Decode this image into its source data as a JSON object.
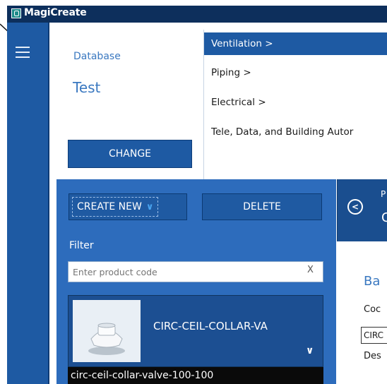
{
  "window": {
    "title": "MagiCreate",
    "icon": "app-logo-icon"
  },
  "nav": {
    "menu_icon": "hamburger-icon"
  },
  "database": {
    "label": "Database",
    "value": "Test",
    "change_label": "CHANGE"
  },
  "categories": [
    {
      "label": "Ventilation  >",
      "selected": true
    },
    {
      "label": "Piping  >",
      "selected": false
    },
    {
      "label": "Electrical  >",
      "selected": false
    },
    {
      "label": "Tele, Data, and Building Autor",
      "selected": false
    }
  ],
  "toolbar": {
    "create_label": "CREATE NEW",
    "create_icon": "chevron-down-icon",
    "delete_label": "DELETE"
  },
  "filter": {
    "label": "Filter",
    "placeholder": "Enter product code",
    "clear_label": "X"
  },
  "product": {
    "name": "CIRC-CEIL-COLLAR-VA",
    "description": "circ-ceil-collar-valve-100-100",
    "thumbnail_icon": "ceiling-valve-image",
    "expand_icon": "chevron-down-icon"
  },
  "details": {
    "back_icon": "back-circle-icon",
    "header_small": "P",
    "header_big": "C",
    "section_title": "Ba",
    "field1_label": "Coc",
    "field1_value": "CIRC",
    "field2_label": "Des"
  },
  "colors": {
    "titlebar": "#0d2f5c",
    "rail": "#1e5aa3",
    "panel": "#2d6cbc",
    "accent_text": "#3a78c0",
    "dropdown_chevron": "#49a5f0"
  }
}
